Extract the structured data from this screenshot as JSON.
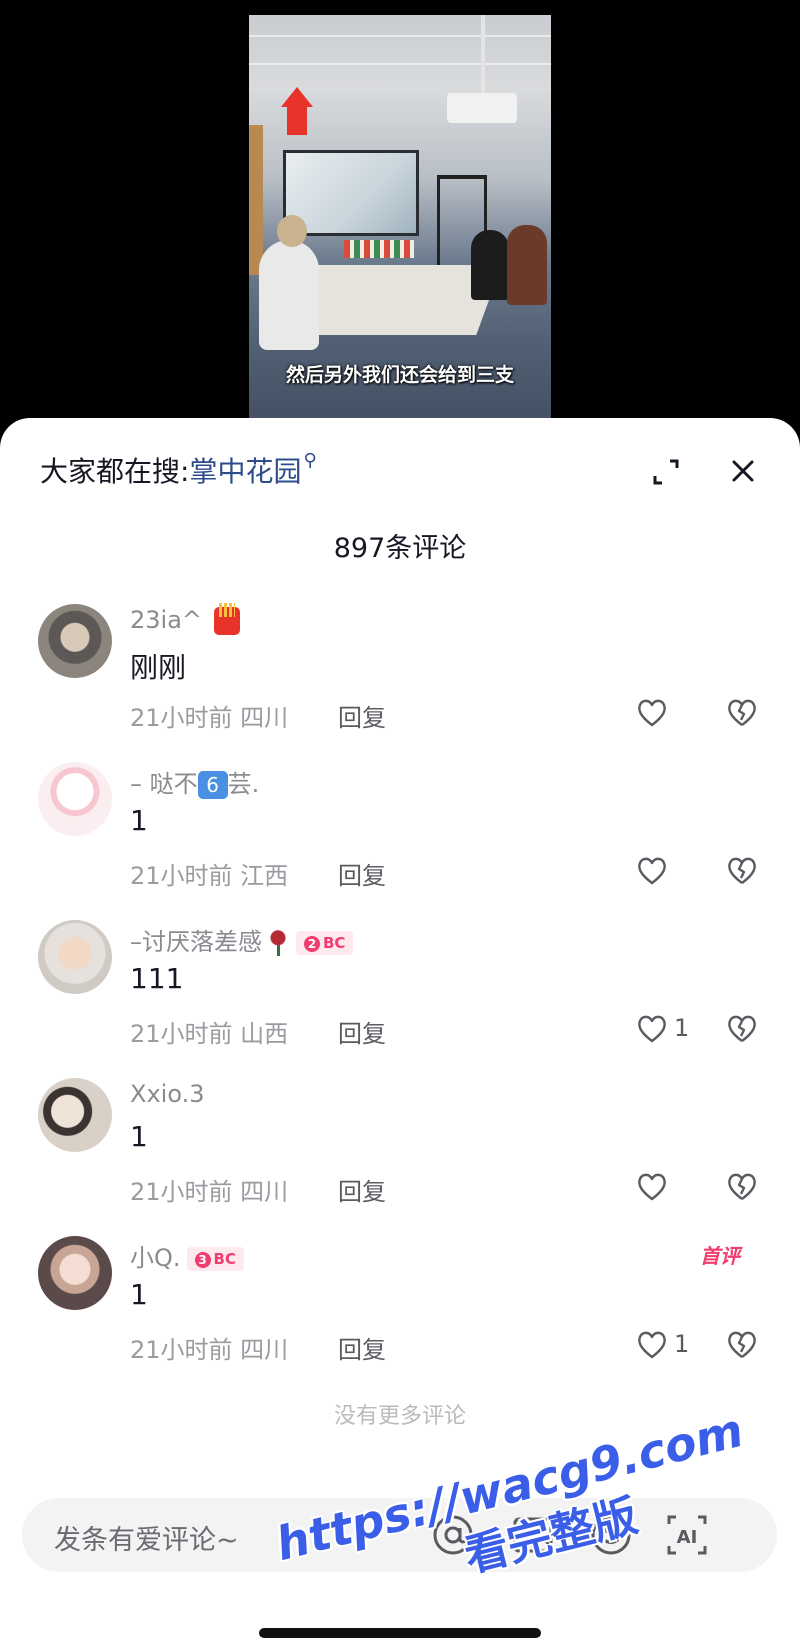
{
  "video": {
    "subtitle": "然后另外我们还会给到三支"
  },
  "sheet": {
    "search_prefix": "大家都在搜:",
    "search_keyword": "掌中花园",
    "comment_count_label": "897条评论",
    "more_label": "没有更多评论"
  },
  "comments": [
    {
      "username": "23ia^",
      "text": "刚刚",
      "time_location": "21小时前 四川",
      "reply": "回复",
      "likes": ""
    },
    {
      "username_a": "– 哒不",
      "username_b": "6",
      "username_c": "芸.",
      "text": "1",
      "time_location": "21小时前 江西",
      "reply": "回复",
      "likes": ""
    },
    {
      "username": "–讨厌落差感",
      "badge_level": "2",
      "badge_text": "BC",
      "text": "111",
      "time_location": "21小时前 山西",
      "reply": "回复",
      "likes": "1"
    },
    {
      "username": "Xxio.3",
      "text": "1",
      "time_location": "21小时前 四川",
      "reply": "回复",
      "likes": ""
    },
    {
      "username": "小Q.",
      "badge_level": "3",
      "badge_text": "BC",
      "first_tag": "首评",
      "text": "1",
      "time_location": "21小时前 四川",
      "reply": "回复",
      "likes": "1"
    }
  ],
  "input": {
    "placeholder": "发条有爱评论~",
    "ai_label": "AI"
  },
  "watermark": {
    "url": "https://wacg9.com",
    "text": "看完整版"
  },
  "icons": [
    "expand-icon",
    "close-icon",
    "heart-icon",
    "broken-heart-icon",
    "at-icon",
    "image-icon",
    "emoji-icon",
    "ai-icon"
  ],
  "colors": {
    "accent_link": "#2e4c8a",
    "badge_pink": "#f03c6f",
    "watermark_blue": "#3a5ee8"
  }
}
